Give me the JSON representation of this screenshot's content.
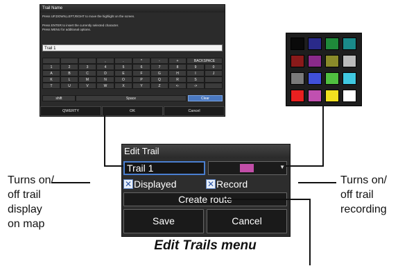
{
  "keyboard_panel": {
    "title": "Trail Name",
    "instructions": [
      "Press UP,DOWN,LEFT,RIGHT to move the highlight on the screen.",
      "Press ENTER to insert the currently selected character.",
      "Press MENU for additional options."
    ],
    "input_value": "Trail 1",
    "rows": [
      [
        "",
        "",
        "",
        ",",
        ".",
        "*",
        "-",
        "+",
        "BACKSPACE"
      ],
      [
        "1",
        "2",
        "3",
        "4",
        "5",
        "6",
        "7",
        "8",
        "9",
        "0"
      ],
      [
        "A",
        "B",
        "C",
        "D",
        "E",
        "F",
        "G",
        "H",
        "I",
        "J"
      ],
      [
        "K",
        "L",
        "M",
        "N",
        "O",
        "P",
        "Q",
        "R",
        "S",
        ""
      ],
      [
        "T",
        "U",
        "V",
        "W",
        "X",
        "Y",
        "Z",
        "<-",
        "->",
        ""
      ]
    ],
    "shift_label": "shift",
    "space_label": "Space",
    "clear_label": "Clear",
    "bottom_buttons": [
      "QWERTY",
      "OK",
      "Cancel"
    ]
  },
  "palette": {
    "colors": [
      "#0a0a0a",
      "#2a2a8a",
      "#1f8a3a",
      "#1a8a8a",
      "#8a1a1a",
      "#8a2a8a",
      "#8a8a2a",
      "#bbbbbb",
      "#7a7a7a",
      "#4050d8",
      "#50c040",
      "#40c8e0",
      "#e82020",
      "#c050b0",
      "#f0e020",
      "#ffffff"
    ]
  },
  "dialog": {
    "title": "Edit Trail",
    "trail_name": "Trail 1",
    "selected_color": "#c24ea8",
    "displayed_label": "Displayed",
    "displayed_checked": true,
    "record_label": "Record",
    "record_checked": true,
    "create_route_label": "Create route",
    "save_label": "Save",
    "cancel_label": "Cancel"
  },
  "callouts": {
    "left": [
      "Turns on/",
      "off trail",
      "display",
      "on map"
    ],
    "right": [
      "Turns on/",
      "off trail",
      "recording"
    ]
  },
  "caption": "Edit Trails menu"
}
